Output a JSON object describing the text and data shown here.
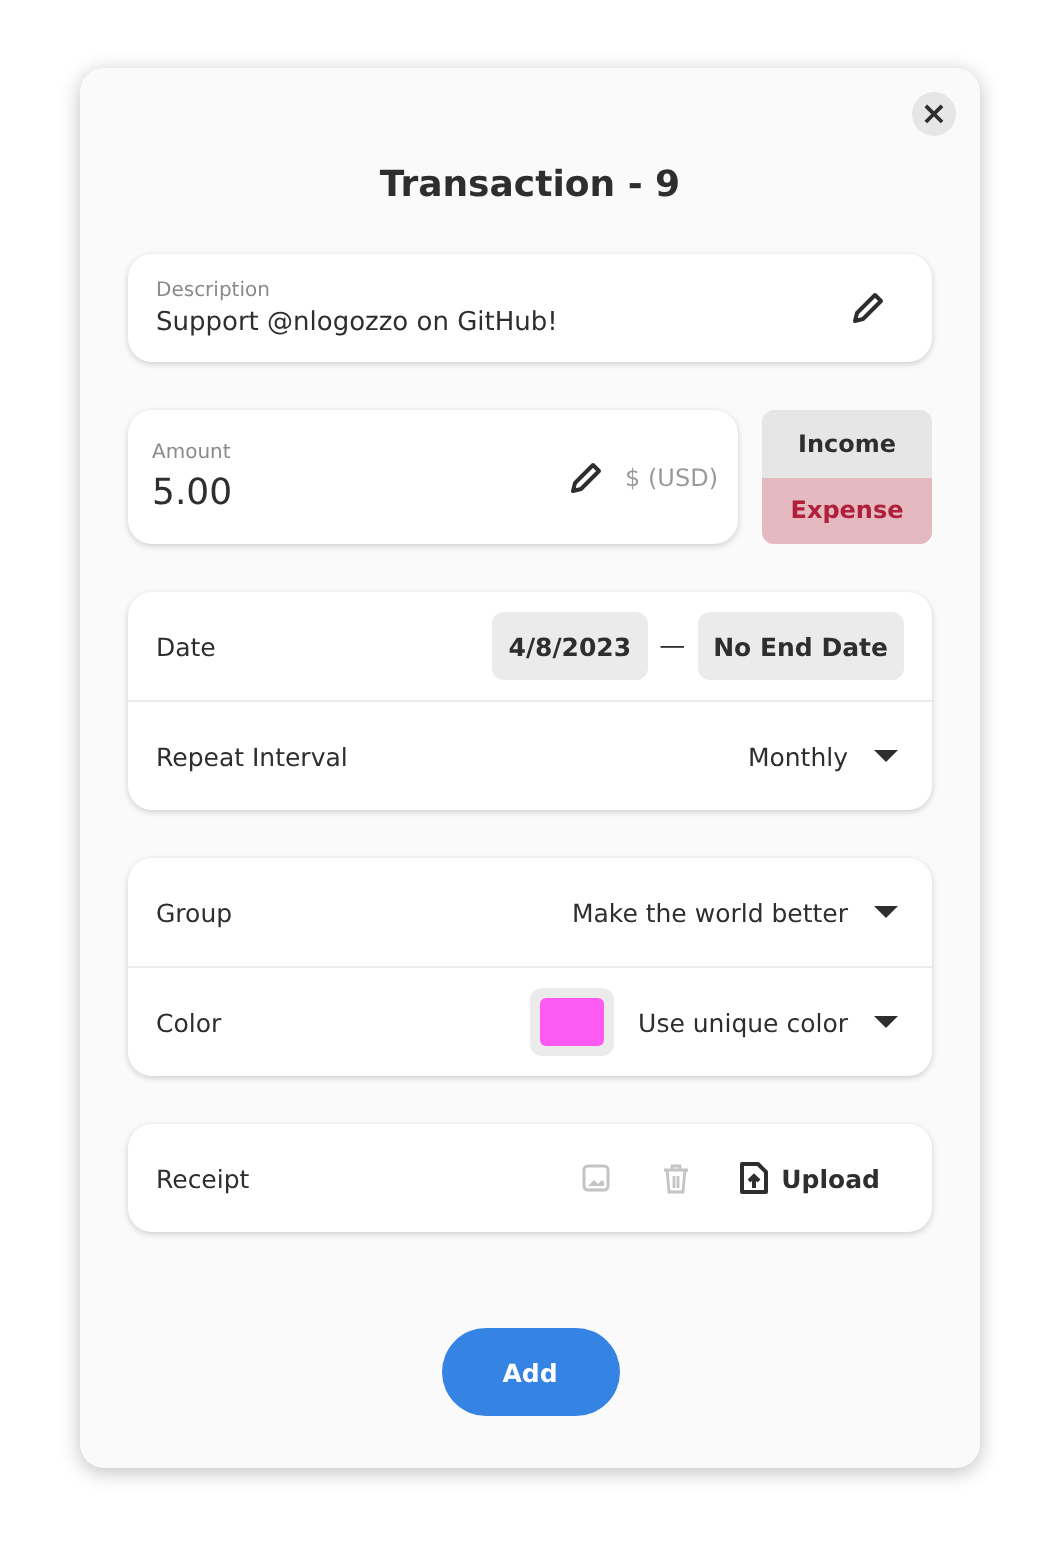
{
  "dialog": {
    "title": "Transaction - 9",
    "close": "×"
  },
  "description": {
    "label": "Description",
    "value": "Support @nlogozzo on GitHub!"
  },
  "amount": {
    "label": "Amount",
    "value": "5.00",
    "currency": "$ (USD)"
  },
  "type_toggle": [
    {
      "label": "Income",
      "selected": false
    },
    {
      "label": "Expense",
      "selected": true
    }
  ],
  "date": {
    "label": "Date",
    "start": "4/8/2023",
    "separator": "—",
    "end": "No End Date"
  },
  "repeat": {
    "label": "Repeat Interval",
    "value": "Monthly"
  },
  "group": {
    "label": "Group",
    "value": "Make the world better"
  },
  "color": {
    "label": "Color",
    "color": "#fc5af0",
    "value": "Use unique color"
  },
  "receipt": {
    "label": "Receipt",
    "actions_disabled": true,
    "upload": "Upload"
  },
  "add_button": "Add"
}
